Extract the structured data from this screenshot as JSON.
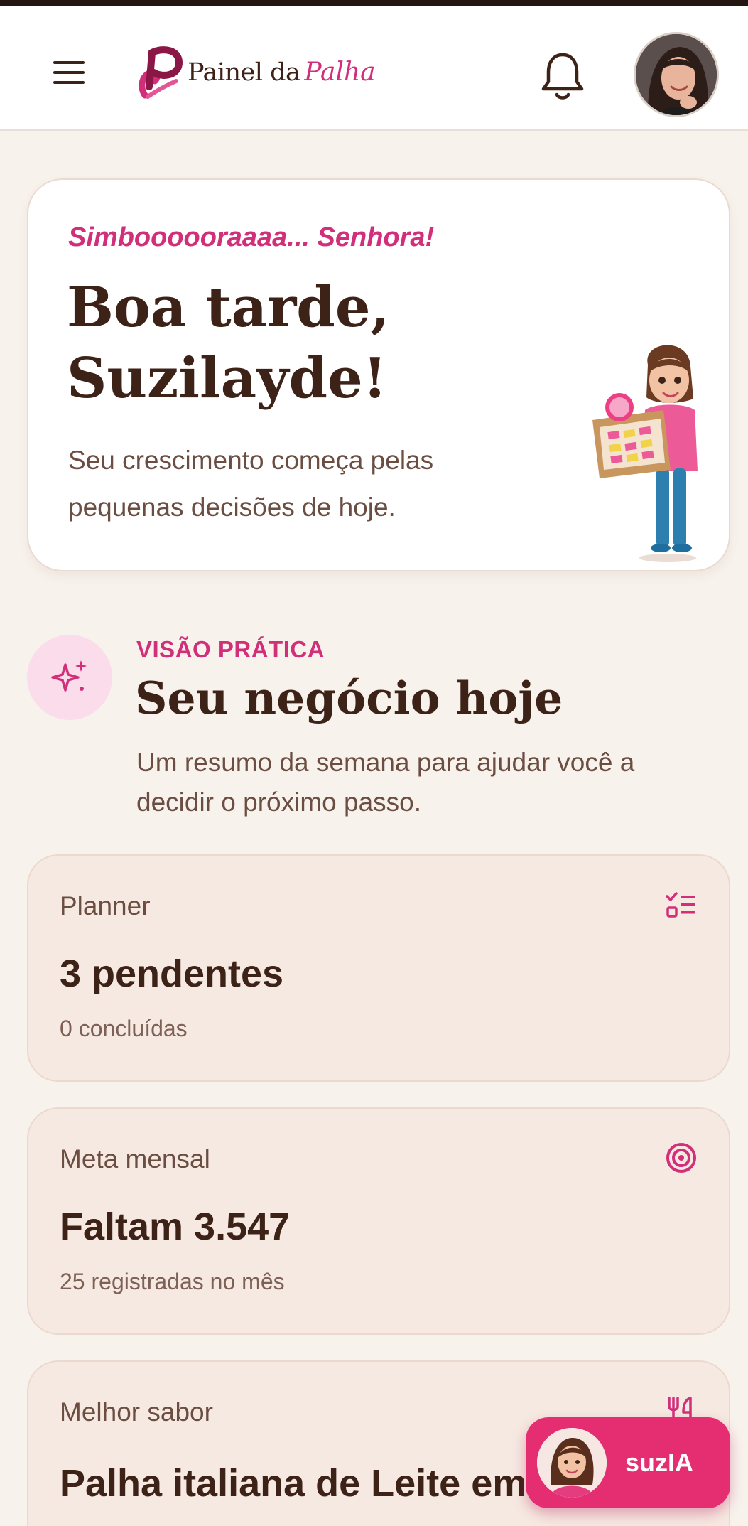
{
  "header": {
    "logo_text": "Painel da",
    "logo_script": "Palha"
  },
  "hero": {
    "kicker": "Simboooooraaaa... Senhora!",
    "title": "Boa tarde, Suzilayde!",
    "subtitle": "Seu crescimento começa pelas pequenas decisões de hoje."
  },
  "section": {
    "kicker": "VISÃO PRÁTICA",
    "title": "Seu negócio hoje",
    "subtitle": "Um resumo da semana para ajudar você a decidir o próximo passo."
  },
  "cards": [
    {
      "label": "Planner",
      "value": "3 pendentes",
      "sub": "0 concluídas",
      "icon": "checklist-icon"
    },
    {
      "label": "Meta mensal",
      "value": "Faltam 3.547",
      "sub": "25 registradas no mês",
      "icon": "target-icon"
    },
    {
      "label": "Melhor sabor",
      "value": "Palha italiana de Leite em",
      "sub": "",
      "icon": "utensils-icon"
    }
  ],
  "assistant": {
    "label": "suzIA"
  },
  "colors": {
    "accent": "#d12f7a",
    "fab": "#e52e72",
    "text_dark": "#3d2218",
    "background": "#f8f2ec",
    "card_bg": "#f6e9e1"
  }
}
